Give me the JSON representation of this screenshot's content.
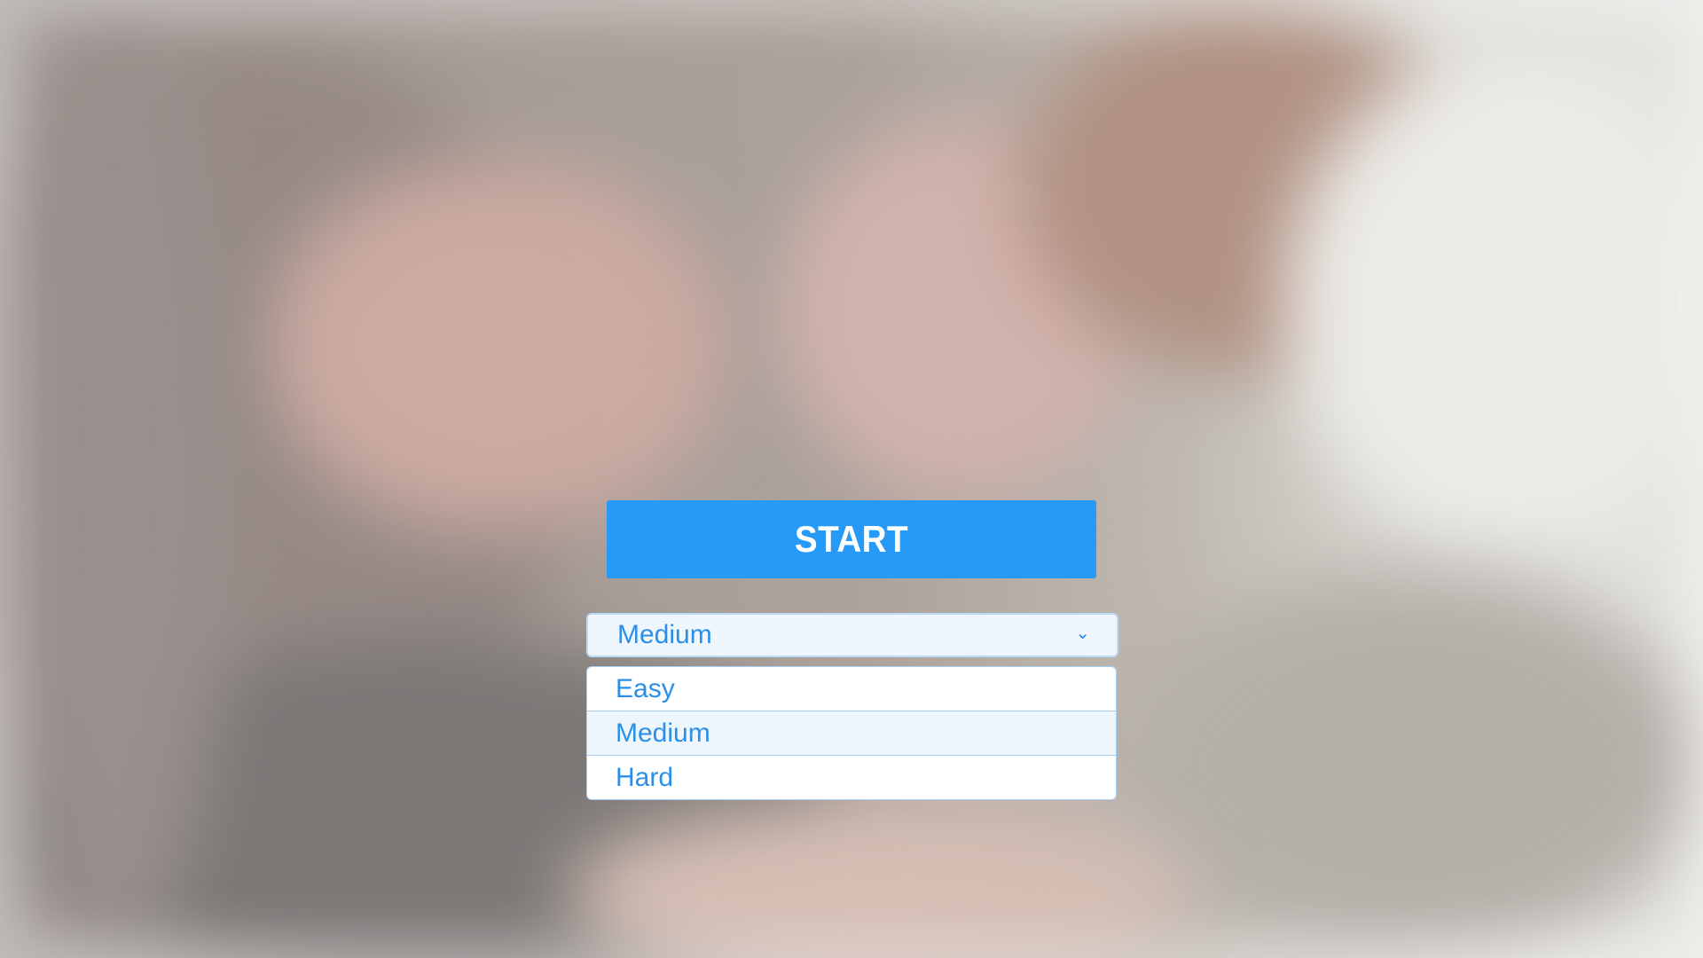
{
  "start_button": {
    "label": "START"
  },
  "difficulty_select": {
    "selected": "Medium",
    "chevron_icon": "chevron-down-icon",
    "options": [
      "Easy",
      "Medium",
      "Hard"
    ],
    "selected_index": 1
  },
  "colors": {
    "accent": "#279af7",
    "text_blue": "#2b8fe8",
    "select_bg": "#eff6fd",
    "select_border": "#bcd9f5"
  }
}
